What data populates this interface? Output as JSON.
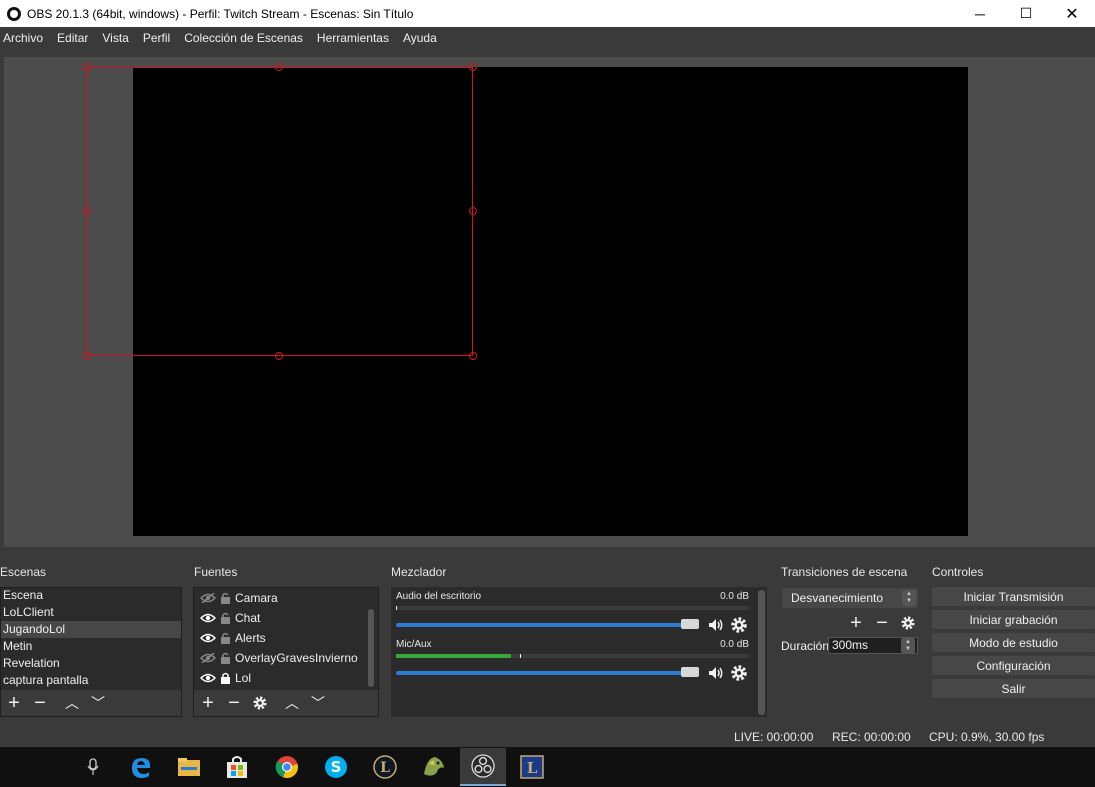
{
  "window": {
    "title": "OBS 20.1.3 (64bit, windows) - Perfil: Twitch Stream - Escenas: Sin Título",
    "minimize": "─",
    "maximize": "☐",
    "close": "✕"
  },
  "menu": [
    "Archivo",
    "Editar",
    "Vista",
    "Perfil",
    "Colección de Escenas",
    "Herramientas",
    "Ayuda"
  ],
  "docks": {
    "scenes_title": "Escenas",
    "sources_title": "Fuentes",
    "mixer_title": "Mezclador",
    "transitions_title": "Transiciones de escena",
    "controls_title": "Controles"
  },
  "scenes": {
    "items": [
      "Escena",
      "LoLClient",
      "JugandoLol",
      "Metin",
      "Revelation",
      "captura pantalla"
    ],
    "selected_index": 2
  },
  "sources": {
    "items": [
      {
        "name": "Camara",
        "visible": false,
        "locked": false
      },
      {
        "name": "Chat",
        "visible": true,
        "locked": false
      },
      {
        "name": "Alerts",
        "visible": true,
        "locked": false
      },
      {
        "name": "OverlayGravesInvierno",
        "visible": false,
        "locked": false
      },
      {
        "name": "Lol",
        "visible": true,
        "locked": true
      }
    ]
  },
  "mixer": {
    "tracks": [
      {
        "name": "Audio del escritorio",
        "db": "0.0 dB",
        "level": 0.0,
        "volume": 1.0
      },
      {
        "name": "Mic/Aux",
        "db": "0.0 dB",
        "level": 0.35,
        "volume": 1.0
      }
    ]
  },
  "transitions": {
    "selected": "Desvanecimiento",
    "duration_label": "Duración",
    "duration_value": "300ms"
  },
  "controls": [
    "Iniciar Transmisión",
    "Iniciar grabación",
    "Modo de estudio",
    "Configuración",
    "Salir"
  ],
  "status": {
    "live": "LIVE: 00:00:00",
    "rec": "REC: 00:00:00",
    "cpu": "CPU: 0.9%, 30.00 fps"
  },
  "toolbar_glyphs": {
    "add": "+",
    "remove": "−",
    "up": "︿",
    "down": "﹀"
  },
  "colors": {
    "selection": "#d0161d",
    "slider": "#2e7bd6",
    "meter": "#38a838"
  },
  "taskbar_icons": [
    "microphone-icon",
    "edge-icon",
    "file-explorer-icon",
    "store-icon",
    "chrome-icon",
    "skype-icon",
    "league-client-icon",
    "game-icon",
    "obs-icon",
    "league-launcher-icon"
  ]
}
